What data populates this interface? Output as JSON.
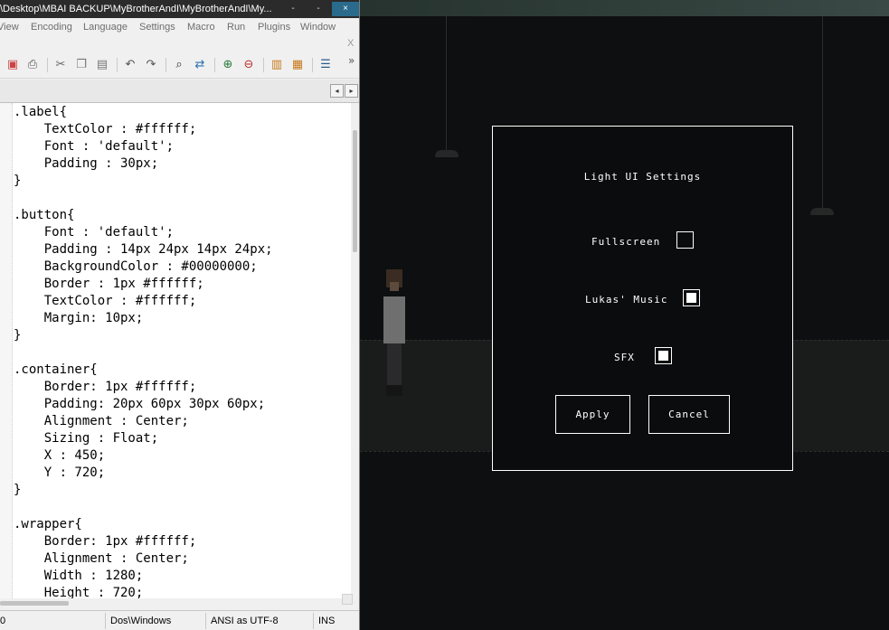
{
  "editor": {
    "window_title": "\\Desktop\\MBAI BACKUP\\MyBrotherAndI\\MyBrotherAndI\\My...",
    "window_controls": {
      "minimize": "-",
      "restore": "-",
      "close": "×"
    },
    "menu": [
      "View",
      "Encoding",
      "Language",
      "Settings",
      "Macro",
      "Run",
      "Plugins",
      "Window"
    ],
    "menu_close": "X",
    "toolbar_more": "»",
    "tab_scroll": {
      "left": "◂",
      "right": "▸"
    },
    "code_lines": [
      ".label{",
      "    TextColor : #ffffff;",
      "    Font : 'default';",
      "    Padding : 30px;",
      "}",
      "",
      ".button{",
      "    Font : 'default';",
      "    Padding : 14px 24px 14px 24px;",
      "    BackgroundColor : #00000000;",
      "    Border : 1px #ffffff;",
      "    TextColor : #ffffff;",
      "    Margin: 10px;",
      "}",
      "",
      ".container{",
      "    Border: 1px #ffffff;",
      "    Padding: 20px 60px 30px 60px;",
      "    Alignment : Center;",
      "    Sizing : Float;",
      "    X : 450;",
      "    Y : 720;",
      "}",
      "",
      ".wrapper{",
      "    Border: 1px #ffffff;",
      "    Alignment : Center;",
      "    Width : 1280;",
      "    Height : 720;"
    ],
    "status": {
      "position": "0",
      "eol": "Dos\\Windows",
      "encoding": "ANSI as UTF-8",
      "mode": "INS"
    }
  },
  "settings_dialog": {
    "title": "Light UI Settings",
    "options": [
      {
        "label": "Fullscreen",
        "checked": false
      },
      {
        "label": "Lukas' Music",
        "checked": true
      },
      {
        "label": "SFX",
        "checked": true
      }
    ],
    "apply_label": "Apply",
    "cancel_label": "Cancel"
  },
  "colors": {
    "dialog_border": "#ffffff",
    "game_background": "#0d0f10",
    "titlebar_background": "#2b2b2b",
    "close_button": "#2a6b8c"
  },
  "icons": [
    "close-file-icon",
    "print-icon",
    "cut-icon",
    "copy-icon",
    "paste-icon",
    "undo-icon",
    "redo-icon",
    "find-icon",
    "replace-icon",
    "zoom-in-icon",
    "zoom-out-icon",
    "sync-vertical-icon",
    "sync-horizontal-icon",
    "word-wrap-icon"
  ]
}
